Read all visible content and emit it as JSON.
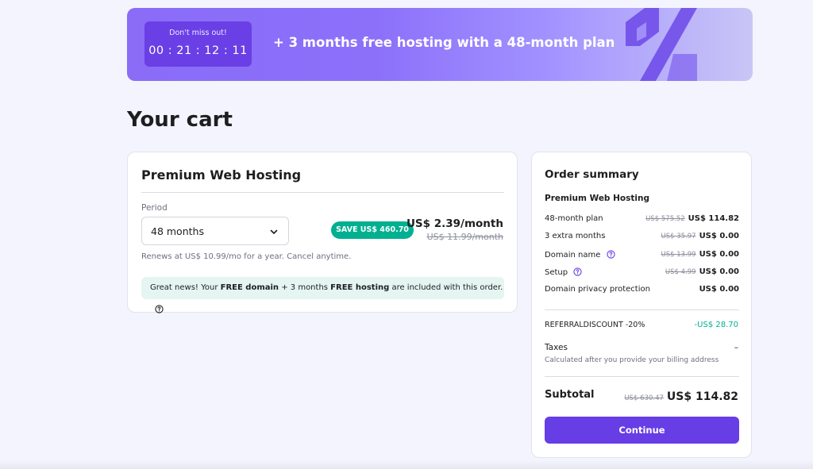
{
  "banner": {
    "countdown_label": "Don't miss out!",
    "countdown_time": "00 : 21 : 12 : 11",
    "promo_text": "+ 3 months free hosting with a 48-month plan"
  },
  "page": {
    "title": "Your cart"
  },
  "cart": {
    "product_name": "Premium Web Hosting",
    "period_label": "Period",
    "period_value": "48 months",
    "save_badge": "SAVE US$ 460.70",
    "price_month": "US$ 2.39/month",
    "price_old": "US$ 11.99/month",
    "renew_note": "Renews at US$ 10.99/mo for a year. Cancel anytime.",
    "info": {
      "part1": "Great news! Your ",
      "bold1": "FREE domain",
      "part2": " + 3 months ",
      "bold2": "FREE hosting",
      "part3": " are included with this order."
    }
  },
  "summary": {
    "title": "Order summary",
    "product": "Premium Web Hosting",
    "items": [
      {
        "label": "48-month plan",
        "old": "US$ 575.52",
        "new": "US$ 114.82"
      },
      {
        "label": "3 extra months",
        "old": "US$ 35.97",
        "new": "US$ 0.00"
      },
      {
        "label": "Domain name",
        "old": "US$ 13.99",
        "new": "US$ 0.00"
      },
      {
        "label": "Setup",
        "old": "US$ 4.99",
        "new": "US$ 0.00"
      },
      {
        "label": "Domain privacy protection",
        "old": "",
        "new": "US$ 0.00"
      }
    ],
    "discount_label": "REFERRALDISCOUNT -20%",
    "discount_value": "-US$ 28.70",
    "taxes_label": "Taxes",
    "taxes_value": "–",
    "taxes_note": "Calculated after you provide your billing address",
    "subtotal_label": "Subtotal",
    "subtotal_old": "US$ 630.47",
    "subtotal_new": "US$ 114.82",
    "continue_label": "Continue"
  },
  "colors": {
    "accent": "#673de6",
    "success": "#00b090",
    "background": "#f4f4ff"
  },
  "icons": {
    "period_select": "chevron-down-icon",
    "help": "question-circle-icon",
    "banner_decoration": "percent-icon"
  }
}
